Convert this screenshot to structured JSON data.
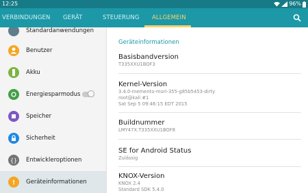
{
  "status_bar": {
    "time": "12:25",
    "battery": "96%"
  },
  "tabs": [
    {
      "label": "VERBINDUNGEN"
    },
    {
      "label": "GERÄT"
    },
    {
      "label": "STEUERUNG"
    },
    {
      "label": "ALLGEMEIN"
    }
  ],
  "colors": {
    "accent": "#1c98a7",
    "status_bar": "#177b87",
    "active_tab": "#ffd36b"
  },
  "sidebar": {
    "items": [
      {
        "label": "Standardanwendungen",
        "icon": "default-apps-icon",
        "color": "#607d8b"
      },
      {
        "label": "Benutzer",
        "icon": "user-icon",
        "color": "#f5a623"
      },
      {
        "label": "Akku",
        "icon": "battery-icon",
        "color": "#7cb342"
      },
      {
        "label": "Energiesparmodus",
        "icon": "power-saving-icon",
        "color": "#43a047",
        "toggle": "off"
      },
      {
        "label": "Speicher",
        "icon": "storage-icon",
        "color": "#7e57c2"
      },
      {
        "label": "Sicherheit",
        "icon": "lock-icon",
        "color": "#1e88e5"
      },
      {
        "label": "Entwickleroptionen",
        "icon": "developer-options-icon",
        "color": "#757575"
      },
      {
        "label": "Geräteinformationen",
        "icon": "info-icon",
        "color": "#f5a623",
        "selected": true
      }
    ]
  },
  "main": {
    "section_title": "Geräteinformationen",
    "entries": [
      {
        "title": "Basisbandversion",
        "value": "T335XXU1BOF3"
      },
      {
        "title": "Kernel-Version",
        "value": "3.4.0-memento-mori-355-g85b5453-dirty\nroot@kali #1\nSat Sep 5 09:46:15 EDT 2015"
      },
      {
        "title": "Buildnummer",
        "value": "LMY47X.T335XXU1BOF8"
      },
      {
        "title": "SE for Android Status",
        "value": "Zulässig"
      },
      {
        "title": "KNOX-Version",
        "value": "KNOX 2.4\nStandard SDK 5.4.0"
      }
    ]
  }
}
